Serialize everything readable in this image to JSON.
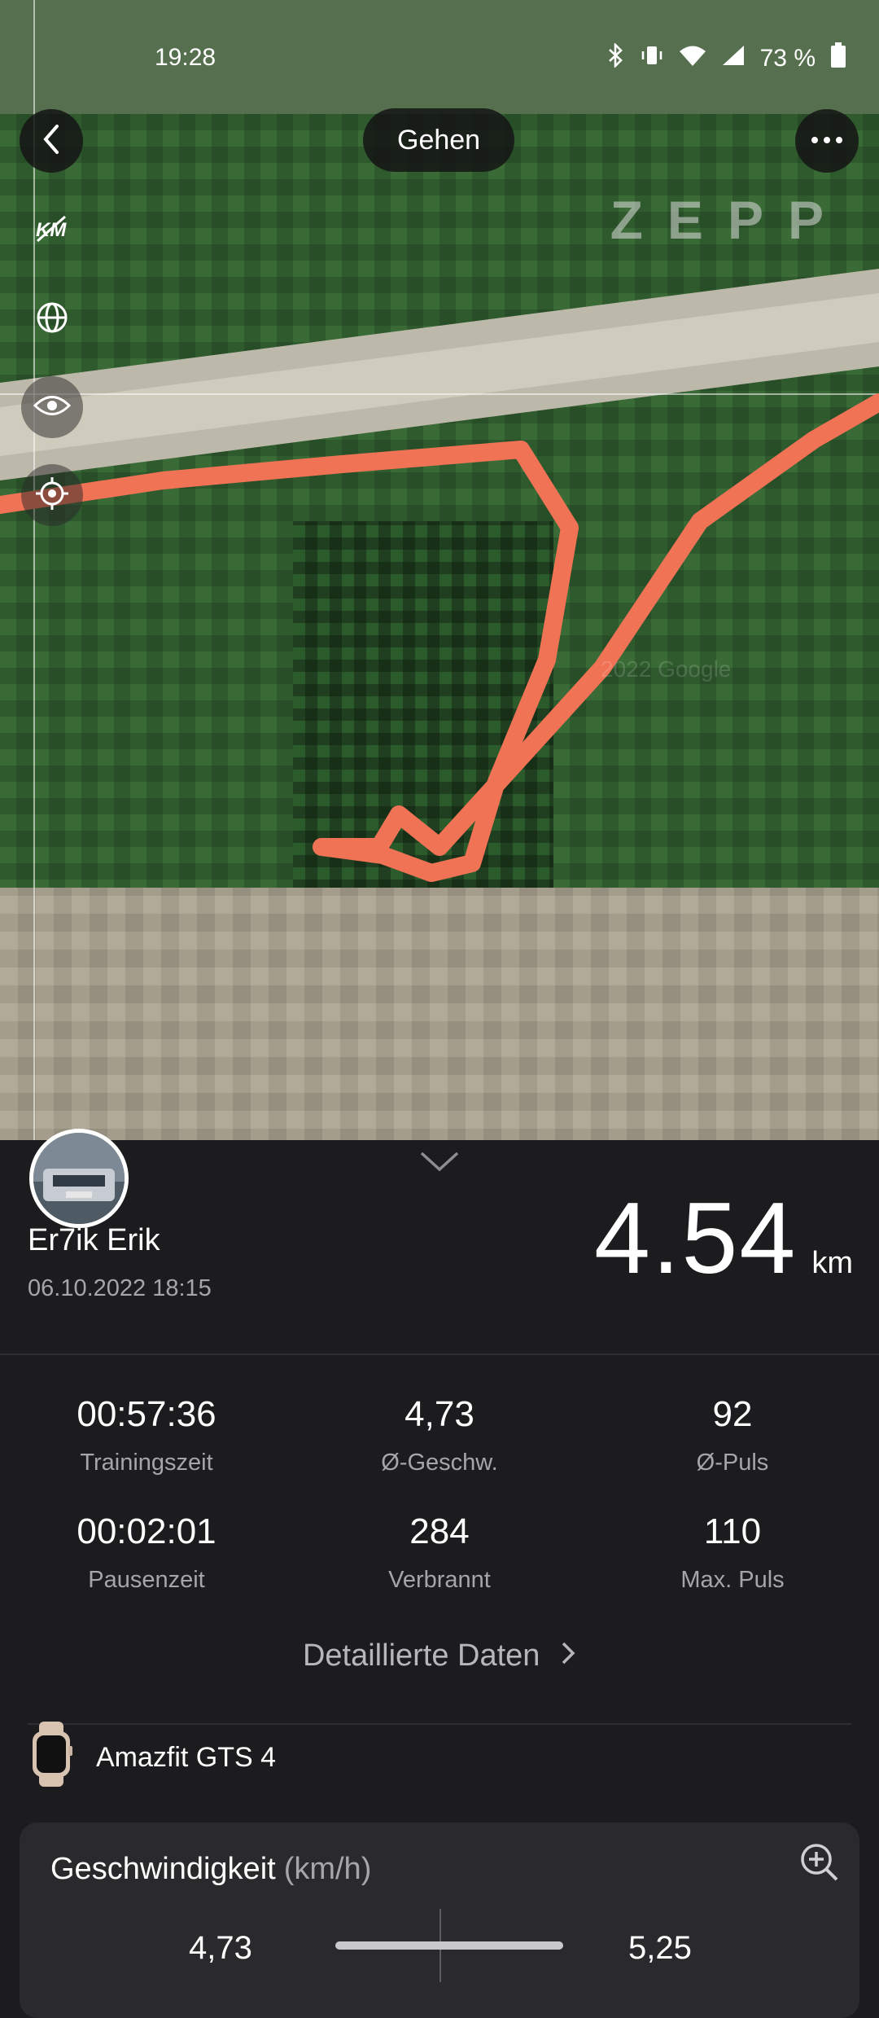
{
  "status_bar": {
    "time": "19:28",
    "battery": "73 %"
  },
  "header": {
    "activity_type": "Gehen",
    "brand": "ZEPP"
  },
  "map": {
    "watermark": "2022 Google",
    "route_color": "#f07355"
  },
  "user": {
    "name": "Er7ik Erik",
    "datetime": "06.10.2022 18:15"
  },
  "summary": {
    "distance": "4.54",
    "distance_unit": "km"
  },
  "stats": [
    {
      "value": "00:57:36",
      "label": "Trainingszeit"
    },
    {
      "value": "4,73",
      "label": "Ø-Geschw."
    },
    {
      "value": "92",
      "label": "Ø-Puls"
    },
    {
      "value": "00:02:01",
      "label": "Pausenzeit"
    },
    {
      "value": "284",
      "label": "Verbrannt"
    },
    {
      "value": "110",
      "label": "Max. Puls"
    }
  ],
  "details_link": "Detaillierte Daten",
  "device": {
    "name": "Amazfit GTS 4"
  },
  "speed_card": {
    "title": "Geschwindigkeit",
    "unit": "(km/h)",
    "min_value": "4,73",
    "max_value": "5,25"
  }
}
